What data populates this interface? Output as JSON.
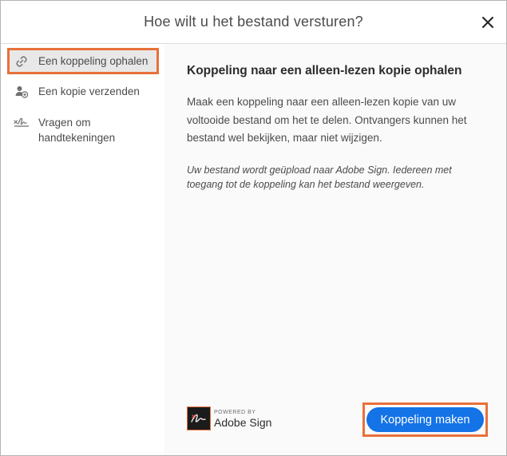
{
  "dialog": {
    "title": "Hoe wilt u het bestand versturen?"
  },
  "sidebar": {
    "items": [
      {
        "label": "Een koppeling ophalen",
        "icon": "link-icon",
        "active": true
      },
      {
        "label": "Een kopie verzenden",
        "icon": "send-copy-icon",
        "active": false
      },
      {
        "label_line1": "Vragen om",
        "label_line2": "handtekeningen",
        "icon": "signature-icon",
        "active": false
      }
    ]
  },
  "content": {
    "heading": "Koppeling naar een alleen-lezen kopie ophalen",
    "description": "Maak een koppeling naar een alleen-lezen kopie van uw voltooide bestand om het te delen. Ontvangers kunnen het bestand wel bekijken, maar niet wijzigen.",
    "note": "Uw bestand wordt geüpload naar Adobe Sign. Iedereen met toegang tot de koppeling kan het bestand weergeven."
  },
  "brand": {
    "powered_by": "POWERED BY",
    "name": "Adobe Sign"
  },
  "actions": {
    "create_link_label": "Koppeling maken"
  },
  "colors": {
    "accent": "#1473e6",
    "highlight": "#e8703a"
  }
}
